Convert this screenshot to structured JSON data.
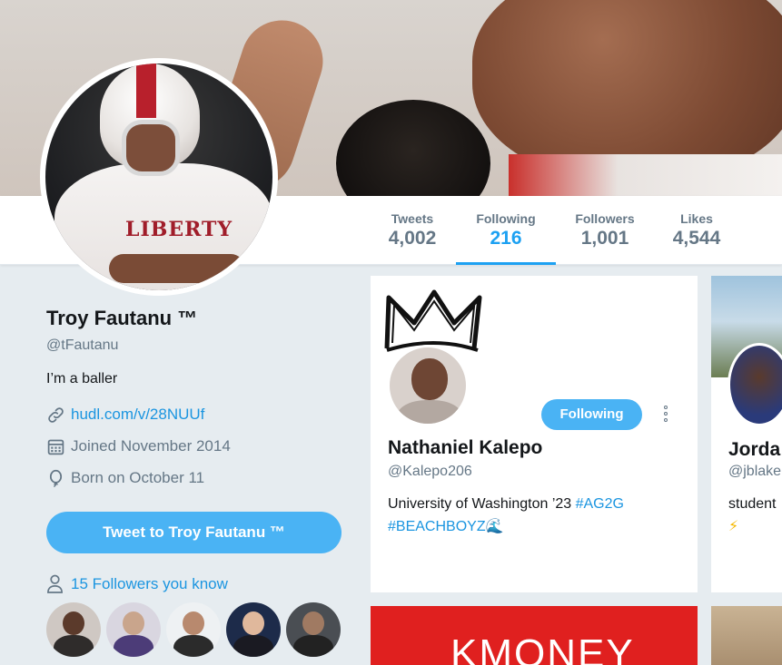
{
  "stats": [
    {
      "label": "Tweets",
      "value": "4,002"
    },
    {
      "label": "Following",
      "value": "216"
    },
    {
      "label": "Followers",
      "value": "1,001"
    },
    {
      "label": "Likes",
      "value": "4,544"
    }
  ],
  "profile": {
    "name": "Troy Fautanu ™",
    "handle": "@tFautanu",
    "bio": "I’m a baller",
    "link": "hudl.com/v/28NUUf",
    "joined": "Joined November 2014",
    "born": "Born on October 11",
    "tweet_to_label": "Tweet to Troy Fautanu ™",
    "followers_you_know": "15 Followers you know",
    "avatar_jersey_text": "LIBERTY"
  },
  "cards": [
    {
      "name": "Nathaniel Kalepo",
      "handle": "@Kalepo206",
      "bio_text": "University of Washington ’23 ",
      "tag1": "#AG2G",
      "tag2": "#BEACHBOYZ",
      "emoji": "🌊",
      "follow_label": "Following"
    },
    {
      "name": "Jorda",
      "handle": "@jblake",
      "bio": "student",
      "emoji": "⚡"
    },
    {
      "banner_text": "KMONEY"
    }
  ],
  "colors": {
    "accent": "#1da1f2",
    "button": "#4ab3f4",
    "link": "#1b95e0",
    "muted": "#657786",
    "background": "#e6ecf0"
  }
}
